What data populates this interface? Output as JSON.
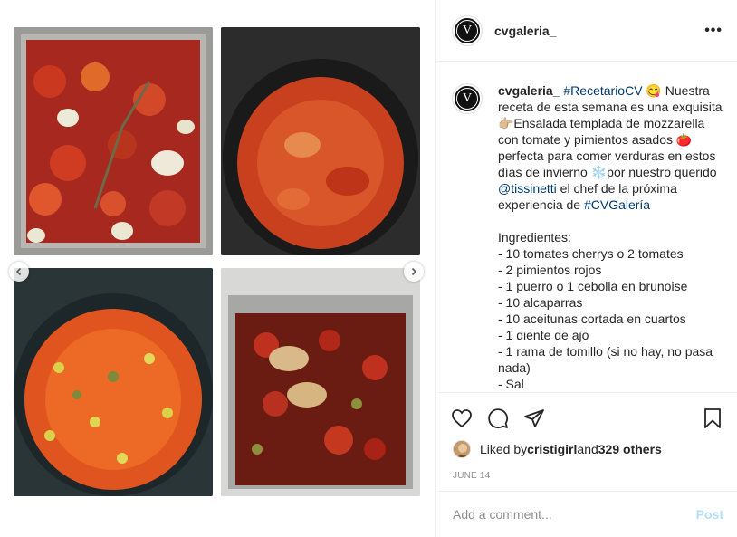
{
  "post": {
    "username": "cvgaleria_",
    "avatar_letter": "V"
  },
  "caption": {
    "username": "cvgaleria_",
    "hashtag1": "#RecetarioCV",
    "text1": " 😋 Nuestra receta de esta semana es una exquisita 👉🏼Ensalada templada de mozzarella con tomate y pimientos asados 🍅 perfecta para comer verduras en estos días de invierno ❄️por nuestro querido ",
    "mention": "@tissinetti",
    "text2": " el chef de la próxima experiencia de ",
    "hashtag2": "#CVGalería",
    "ingredients": "\n\nIngredientes:\n- 10 tomates cherrys o 2 tomates\n- 2 pimientos rojos\n- 1 puerro o 1 cebolla en brunoise\n- 10 alcaparras\n- 10 aceitunas cortada en cuartos\n- 1 diente de ajo\n- 1 rama de tomillo (si no hay, no pasa nada)\n- Sal"
  },
  "likes": {
    "prefix": "Liked by ",
    "user": "cristigirl",
    "and": " and ",
    "others": "329 others"
  },
  "date": "JUNE 14",
  "comment": {
    "placeholder": "Add a comment...",
    "post_label": "Post"
  },
  "icons": {
    "heart": "heart-icon",
    "comment": "comment-icon",
    "share": "share-icon",
    "bookmark": "bookmark-icon",
    "more": "more-icon"
  },
  "colors": {
    "link": "#00376b",
    "post_disabled": "#b2dffc",
    "muted": "#8e8e8e"
  }
}
